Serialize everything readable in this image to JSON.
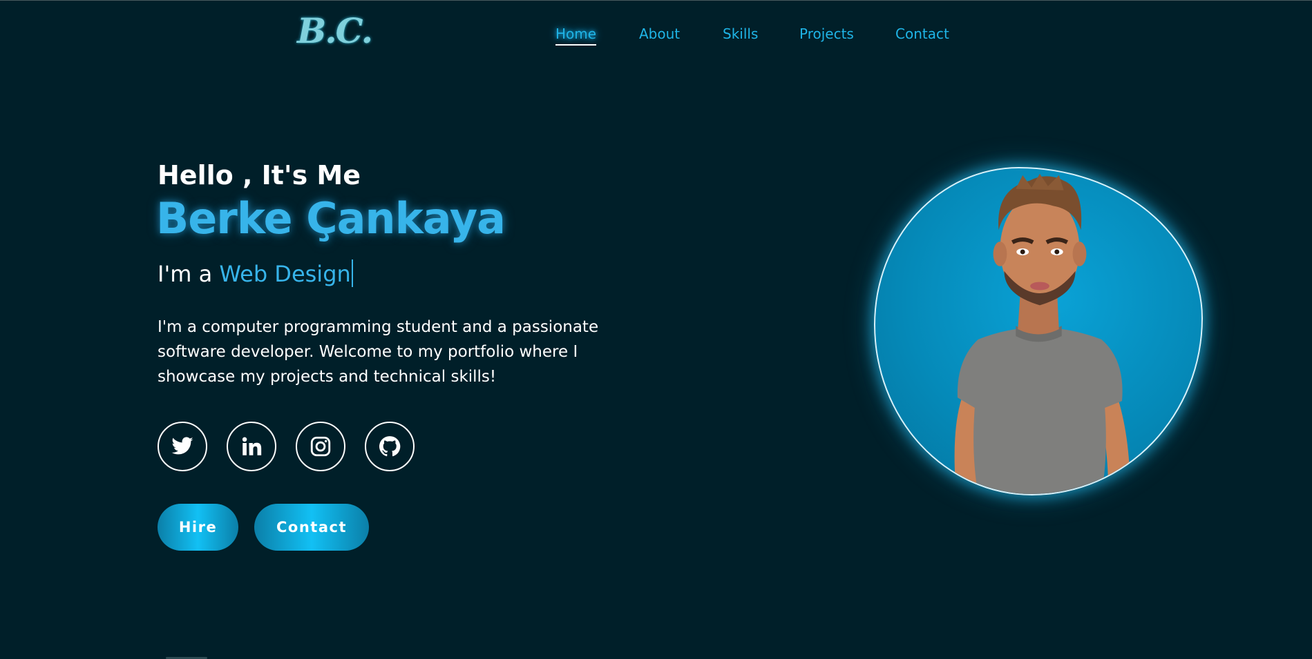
{
  "header": {
    "logo_text": "B.C.",
    "nav": [
      {
        "label": "Home",
        "active": true
      },
      {
        "label": "About",
        "active": false
      },
      {
        "label": "Skills",
        "active": false
      },
      {
        "label": "Projects",
        "active": false
      },
      {
        "label": "Contact",
        "active": false
      }
    ]
  },
  "hero": {
    "greeting": "Hello , It's Me",
    "name": "Berke Çankaya",
    "role_prefix": "I'm a ",
    "role_typed": "Web Design",
    "description": "I'm a computer programming student and a passionate software developer. Welcome to my portfolio where I showcase my projects and technical skills!",
    "social": [
      {
        "icon": "twitter-icon"
      },
      {
        "icon": "linkedin-icon"
      },
      {
        "icon": "instagram-icon"
      },
      {
        "icon": "github-icon"
      }
    ],
    "buttons": {
      "hire_label": "Hire",
      "contact_label": "Contact"
    }
  },
  "colors": {
    "background": "#001f29",
    "accent": "#37b4ea",
    "nav_link": "#1fb4e6",
    "button_gradient_start": "#0b7fa8",
    "button_gradient_mid": "#12c0f4"
  }
}
